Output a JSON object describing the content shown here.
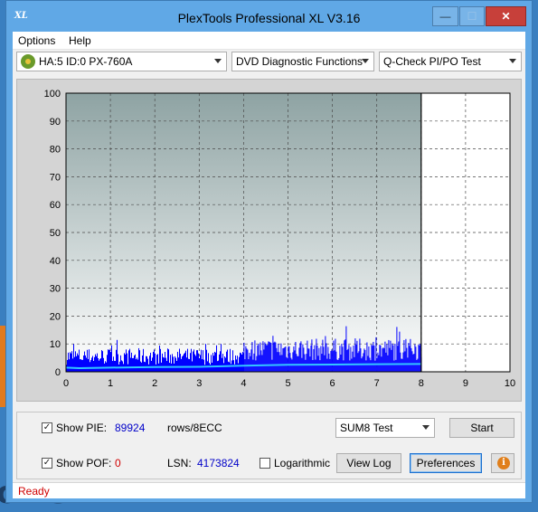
{
  "window": {
    "title": "PlexTools Professional XL V3.16",
    "min_glyph": "—",
    "max_glyph": "☐",
    "close_glyph": "✕",
    "app_icon_text": "XL"
  },
  "menu": {
    "items": [
      "Options",
      "Help"
    ]
  },
  "toolbar": {
    "drive": "HA:5 ID:0  PX-760A",
    "function": "DVD Diagnostic Functions",
    "test": "Q-Check PI/PO Test"
  },
  "chart_data": {
    "type": "bar",
    "x_ticks": [
      "0",
      "1",
      "2",
      "3",
      "4",
      "5",
      "6",
      "7",
      "8",
      "9",
      "10"
    ],
    "y_ticks": [
      "0",
      "10",
      "20",
      "30",
      "40",
      "50",
      "60",
      "70",
      "80",
      "90",
      "100"
    ],
    "xlim": [
      0,
      10
    ],
    "ylim": [
      0,
      100
    ],
    "grid": true,
    "end_marker_x": 8,
    "series": [
      {
        "color": "#0000ff",
        "segments": [
          {
            "x": [
              0,
              4
            ],
            "base": 5.5,
            "range": 6,
            "spike_max": 12
          },
          {
            "x": [
              4,
              8
            ],
            "base": 8,
            "range": 8,
            "spike_max": 16.5
          }
        ]
      },
      {
        "color": "#33c5ff",
        "points": [
          [
            0,
            1.5
          ],
          [
            0.3,
            1.3
          ],
          [
            1,
            1.5
          ],
          [
            2,
            1.7
          ],
          [
            3,
            1.8
          ],
          [
            4,
            2.2
          ],
          [
            5,
            2.5
          ],
          [
            6,
            2.6
          ],
          [
            7,
            2.7
          ],
          [
            8,
            2.8
          ]
        ]
      }
    ],
    "colors": {
      "plot_top": "#8ea3a3",
      "plot_bottom": "#ffffff",
      "area_after": "#ffffff"
    }
  },
  "panel": {
    "show_pie_label": "Show PIE:",
    "pie_value": "89924",
    "rows_label": "rows/8ECC",
    "show_pof_label": "Show POF:",
    "pof_value": "0",
    "lsn_label": "LSN:",
    "lsn_value": "4173824",
    "log_label": "Logarithmic",
    "sum_select": "SUM8 Test",
    "start_button": "Start",
    "view_log_button": "View Log",
    "preferences_button": "Preferences",
    "check_mark": "✓"
  },
  "status": {
    "text": "Ready"
  },
  "background": {
    "text": "ows"
  }
}
